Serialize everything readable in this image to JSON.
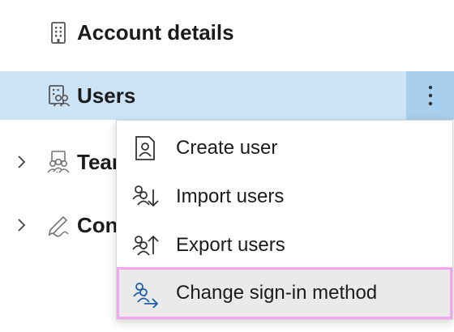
{
  "tree": {
    "items": [
      {
        "label": "Account details",
        "icon": "building-icon",
        "expandable": false
      },
      {
        "label": "Users",
        "icon": "users-building-icon",
        "expandable": false,
        "selected": true
      },
      {
        "label": "Tear",
        "icon": "teams-icon",
        "expandable": true
      },
      {
        "label": "Con",
        "icon": "signature-icon",
        "expandable": true
      }
    ],
    "more_button_icon": "more-vertical-icon"
  },
  "context_menu": {
    "items": [
      {
        "label": "Create user",
        "icon": "person-document-icon"
      },
      {
        "label": "Import users",
        "icon": "people-import-icon"
      },
      {
        "label": "Export users",
        "icon": "people-export-icon"
      },
      {
        "label": "Change sign-in method",
        "icon": "people-swap-icon",
        "highlighted": true
      }
    ]
  },
  "colors": {
    "selected_row": "#cce4f6",
    "more_button": "#a9cfee",
    "highlight_outline": "#f3a5f0",
    "highlight_bg": "#eaeaea",
    "icon_stroke": "#555555"
  }
}
